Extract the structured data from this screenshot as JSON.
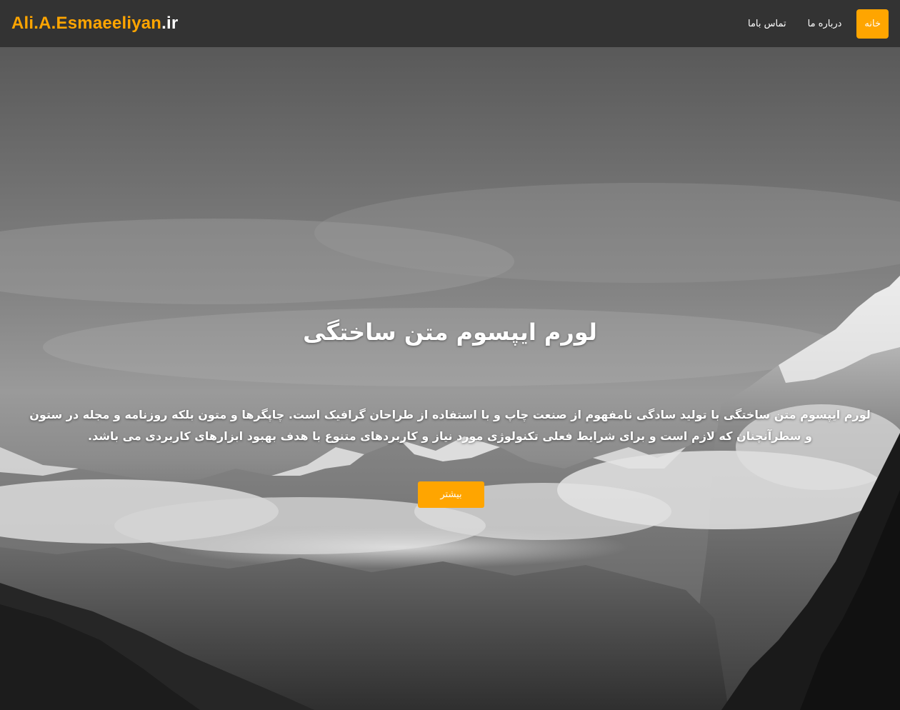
{
  "navbar": {
    "brand_main": "Ali.A.Esmaeeliyan",
    "brand_tld": ".ir",
    "links": [
      {
        "label": "خانه",
        "active": true
      },
      {
        "label": "درباره ما",
        "active": false
      },
      {
        "label": "تماس باما",
        "active": false
      }
    ]
  },
  "hero": {
    "title": "لورم ایپسوم متن ساختگی",
    "text": "لورم ایپسوم متن ساختگی با تولید سادگی نامفهوم از صنعت چاپ و با استفاده از طراحان گرافیک است. چاپگرها و متون بلکه روزنامه و مجله در ستون و سطرآنچنان که لازم است و برای شرایط فعلی تکنولوژی مورد نیاز و کاربردهای متنوع با هدف بهبود ابزارهای کاربردی می باشد.",
    "button_label": "بیشتر"
  },
  "colors": {
    "accent": "#ffa500",
    "navbar_bg": "#333333",
    "text": "#ffffff"
  }
}
